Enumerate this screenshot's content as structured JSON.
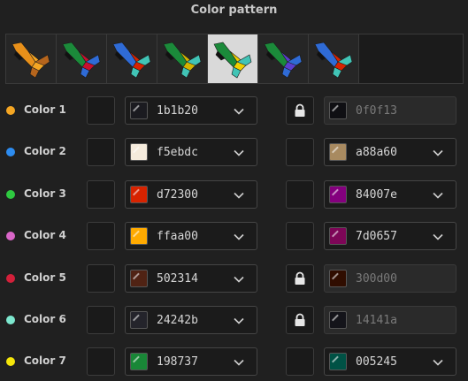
{
  "title": "Color pattern",
  "patterns": [
    {
      "name": "pattern-1",
      "colors": [
        "#e8901a",
        "#f5a623",
        "#b5651d"
      ],
      "selected": false
    },
    {
      "name": "pattern-2",
      "colors": [
        "#1b8a3a",
        "#c8102e",
        "#2f6bd6"
      ],
      "selected": false
    },
    {
      "name": "pattern-3",
      "colors": [
        "#2f6bd6",
        "#d72300",
        "#41c4b6"
      ],
      "selected": false
    },
    {
      "name": "pattern-4",
      "colors": [
        "#1b8a3a",
        "#d4b400",
        "#41c4b6"
      ],
      "selected": false
    },
    {
      "name": "pattern-5",
      "colors": [
        "#1b8a3a",
        "#f0d000",
        "#41c4b6"
      ],
      "selected": true
    },
    {
      "name": "pattern-6",
      "colors": [
        "#1b8a3a",
        "#5a3fd0",
        "#2f6bd6"
      ],
      "selected": false
    },
    {
      "name": "pattern-7",
      "colors": [
        "#2f6bd6",
        "#d72300",
        "#41c4b6"
      ],
      "selected": false
    }
  ],
  "rows": [
    {
      "label": "Color 1",
      "dot": "#f5a623",
      "primary": "1b1b20",
      "primary_color": "#1b1b20",
      "locked": true,
      "secondary": "0f0f13",
      "secondary_color": "#0f0f13"
    },
    {
      "label": "Color 2",
      "dot": "#2d8cf0",
      "primary": "f5ebdc",
      "primary_color": "#f5ebdc",
      "locked": false,
      "secondary": "a88a60",
      "secondary_color": "#a88a60"
    },
    {
      "label": "Color 3",
      "dot": "#2ec940",
      "primary": "d72300",
      "primary_color": "#d72300",
      "locked": false,
      "secondary": "84007e",
      "secondary_color": "#84007e"
    },
    {
      "label": "Color 4",
      "dot": "#d966c8",
      "primary": "ffaa00",
      "primary_color": "#ffaa00",
      "locked": false,
      "secondary": "7d0657",
      "secondary_color": "#7d0657"
    },
    {
      "label": "Color 5",
      "dot": "#d3203a",
      "primary": "502314",
      "primary_color": "#502314",
      "locked": true,
      "secondary": "300d00",
      "secondary_color": "#300d00"
    },
    {
      "label": "Color 6",
      "dot": "#7de8cf",
      "primary": "24242b",
      "primary_color": "#24242b",
      "locked": true,
      "secondary": "14141a",
      "secondary_color": "#14141a"
    },
    {
      "label": "Color 7",
      "dot": "#f5e60a",
      "primary": "198737",
      "primary_color": "#198737",
      "locked": false,
      "secondary": "005245",
      "secondary_color": "#005245"
    }
  ]
}
